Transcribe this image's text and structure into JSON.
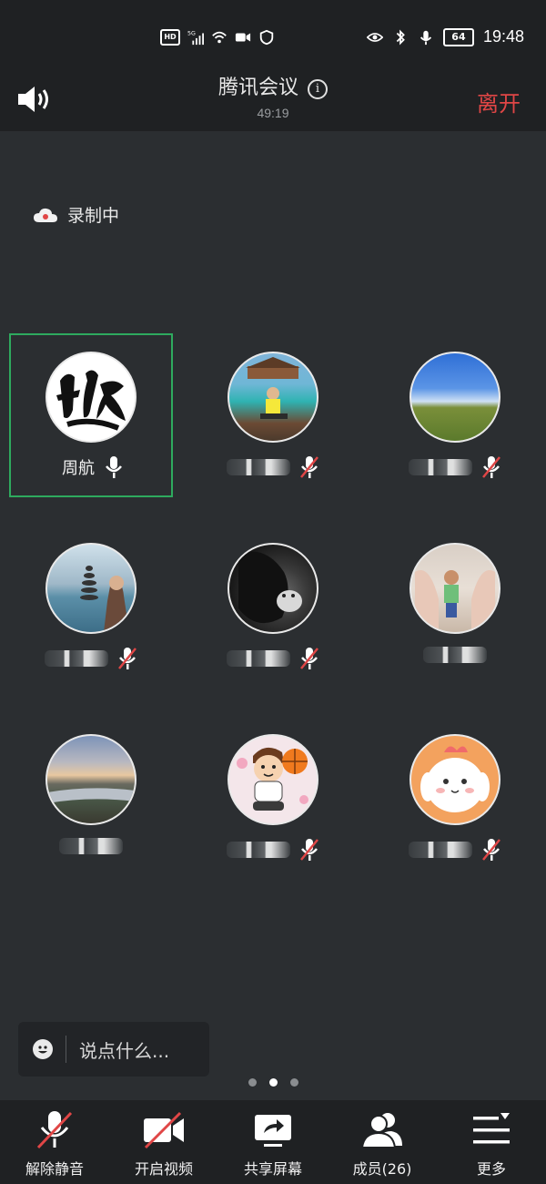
{
  "status": {
    "time": "19:48",
    "battery": "64",
    "hd": "HD",
    "network": "5G"
  },
  "header": {
    "title": "腾讯会议",
    "duration": "49:19",
    "leave_label": "离开"
  },
  "recording_label": "录制中",
  "participants": [
    {
      "name": "周航",
      "muted": false,
      "active": true
    },
    {
      "name": "",
      "muted": true,
      "active": false
    },
    {
      "name": "",
      "muted": true,
      "active": false
    },
    {
      "name": "",
      "muted": true,
      "active": false
    },
    {
      "name": "",
      "muted": true,
      "active": false
    },
    {
      "name": "",
      "muted": false,
      "active": false
    },
    {
      "name": "",
      "muted": false,
      "active": false
    },
    {
      "name": "",
      "muted": true,
      "active": false
    },
    {
      "name": "",
      "muted": true,
      "active": false
    }
  ],
  "chat": {
    "placeholder": "说点什么..."
  },
  "pager": {
    "total": 3,
    "current": 2
  },
  "toolbar": {
    "unmute_label": "解除静音",
    "video_label": "开启视频",
    "share_label": "共享屏幕",
    "members_label": "成员(26)",
    "more_label": "更多"
  },
  "colors": {
    "accent_leave": "#e04646",
    "active_border": "#2eaa5e",
    "mic_on": "#ffffff",
    "muted_slash": "#e04646"
  }
}
